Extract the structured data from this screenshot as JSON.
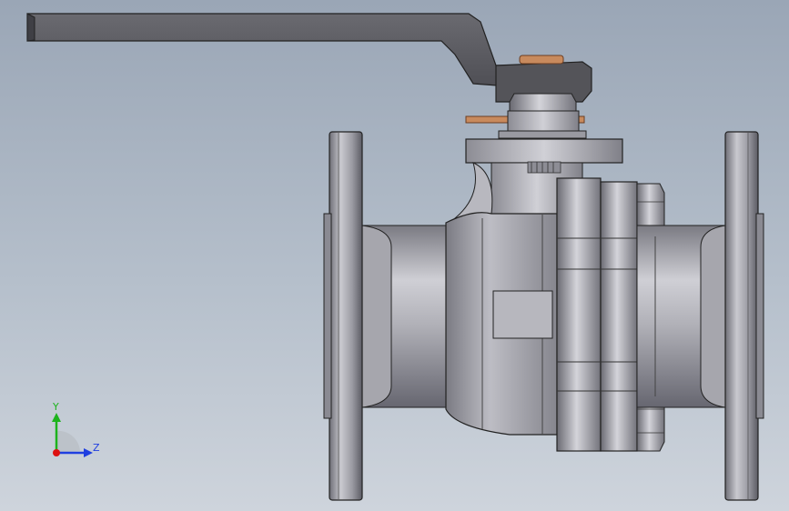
{
  "window": {
    "title": ""
  },
  "triad": {
    "y_label": "Y",
    "z_label": "Z",
    "colors": {
      "y": "#1db31d",
      "z": "#1f3fe0",
      "x": "#e02020",
      "origin": "#d11"
    }
  },
  "colors": {
    "background_top": "#9aa6b6",
    "background_bottom": "#ced4dc",
    "metal_light": "#c9c9cf",
    "metal_mid": "#9c9ca4",
    "metal_dark": "#606068",
    "handle": "#5d5d63",
    "copper": "#c88a5d"
  }
}
